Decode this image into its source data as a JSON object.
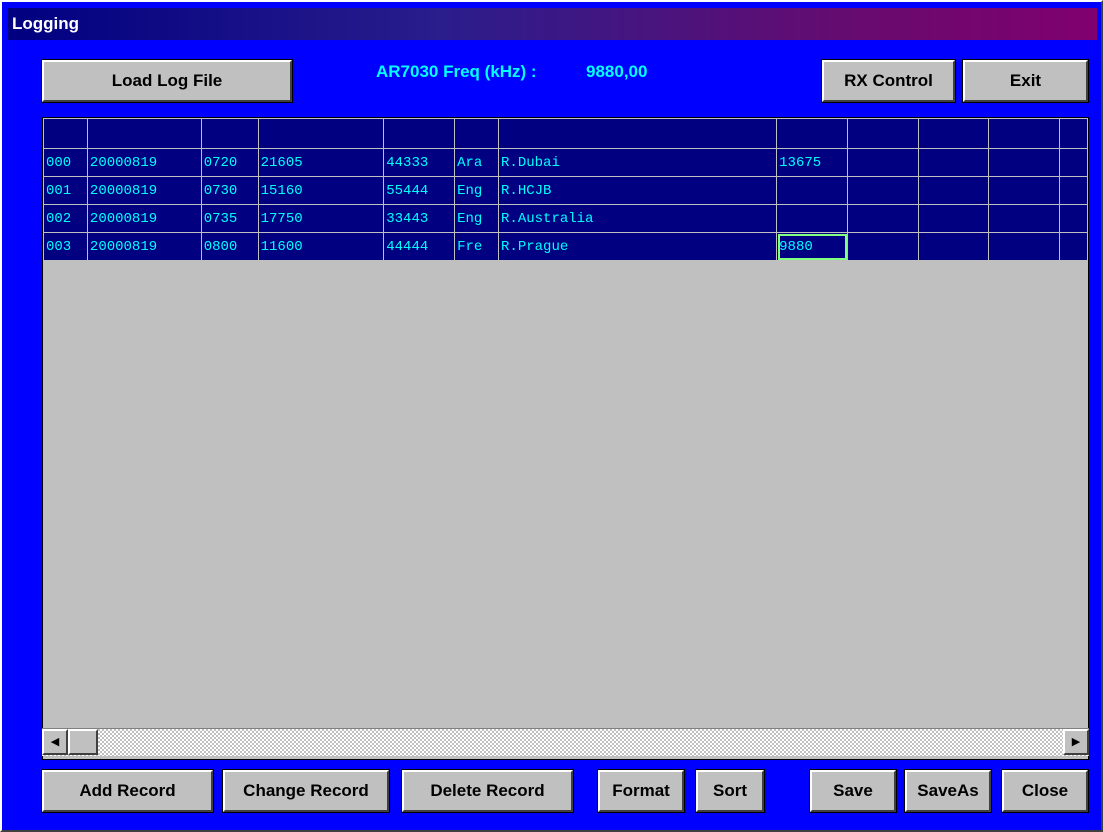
{
  "window": {
    "title": "Logging"
  },
  "header": {
    "load_label": "Load Log File",
    "freq_label": "AR7030 Freq (kHz) :",
    "freq_value": "9880,00",
    "rx_control_label": "RX Control",
    "exit_label": "Exit"
  },
  "grid": {
    "rows": [
      [
        "000",
        "20000819",
        "0720",
        "21605",
        "44333",
        "Ara",
        "R.Dubai",
        "13675",
        "",
        "",
        "",
        ""
      ],
      [
        "001",
        "20000819",
        "0730",
        "15160",
        "55444",
        "Eng",
        "R.HCJB",
        "",
        "",
        "",
        "",
        ""
      ],
      [
        "002",
        "20000819",
        "0735",
        "17750",
        "33443",
        "Eng",
        "R.Australia",
        "",
        "",
        "",
        "",
        ""
      ],
      [
        "003",
        "20000819",
        "0800",
        "11600",
        "44444",
        "Fre",
        "R.Prague",
        "9880",
        "",
        "",
        "",
        ""
      ]
    ]
  },
  "scrollbar": {
    "left_icon": "arrow-left-icon",
    "right_icon": "arrow-right-icon"
  },
  "footer": {
    "add_label": "Add Record",
    "change_label": "Change Record",
    "delete_label": "Delete Record",
    "format_label": "Format",
    "sort_label": "Sort",
    "save_label": "Save",
    "saveas_label": "SaveAs",
    "close_label": "Close"
  },
  "colors": {
    "window_bg": "#0000ff",
    "grid_bg": "#000080",
    "grid_text": "#00ffff",
    "selected_outline": "#80ff80"
  }
}
